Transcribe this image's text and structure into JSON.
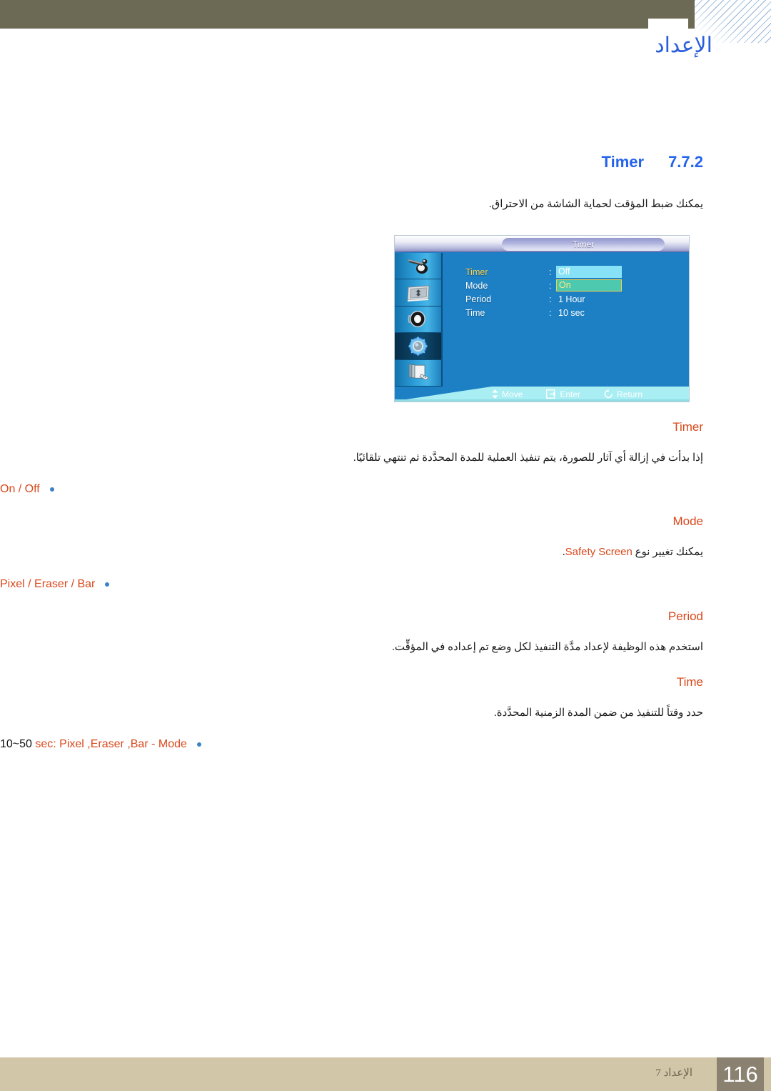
{
  "header": {
    "chapter_title": "الإعداد",
    "notch_icon": "page-corner-notch",
    "hatch_icon": "diagonal-hatch-decoration"
  },
  "section": {
    "number": "7.7.2",
    "name": "Timer",
    "intro": "يمكنك ضبط المؤقت لحماية الشاشة من الاحتراق."
  },
  "osd": {
    "title": "Timer",
    "sidebar_icons": [
      {
        "name": "picture-icon"
      },
      {
        "name": "screen-adjust-icon"
      },
      {
        "name": "sound-speaker-icon"
      },
      {
        "name": "setup-gear-icon",
        "selected": true
      },
      {
        "name": "multi-control-icon"
      }
    ],
    "rows": [
      {
        "label": "Timer",
        "colon": ":",
        "value": "Off",
        "style": "box-cyan",
        "label_highlight": true
      },
      {
        "label": "Mode",
        "colon": ":",
        "value": "On",
        "style": "box-teal",
        "label_highlight": false
      },
      {
        "label": "Period",
        "colon": ":",
        "value": "1 Hour",
        "style": "plain",
        "label_highlight": false
      },
      {
        "label": "Time",
        "colon": ":",
        "value": "10 sec",
        "style": "plain",
        "label_highlight": false
      }
    ],
    "footer": [
      {
        "icon": "up-down-arrow-icon",
        "label": "Move"
      },
      {
        "icon": "enter-key-icon",
        "label": "Enter"
      },
      {
        "icon": "return-arrow-icon",
        "label": "Return"
      }
    ]
  },
  "blocks": [
    {
      "heading": "Timer",
      "paragraph_ar": "إذا بدأت في إزالة أي آثار للصورة، يتم تنفيذ العملية للمدة المحدَّدة ثم تنتهي تلقائيًا.",
      "bullet": "On / Off"
    },
    {
      "heading": "Mode",
      "paragraph_pre": "يمكنك تغيير نوع ",
      "paragraph_en": "Safety Screen",
      "paragraph_post": ".",
      "bullet": "Pixel / Eraser / Bar"
    },
    {
      "heading": "Period",
      "paragraph_ar": "استخدم هذه الوظيفة لإعداد مدَّة التنفيذ لكل وضع تم إعداده في المؤقِّت.",
      "bullet": null
    },
    {
      "heading": "Time",
      "paragraph_ar": "حدد وقتاً للتنفيذ من ضمن المدة الزمنية المحدَّدة.",
      "bullet_black": "10~50",
      "bullet_rest": " sec: Pixel ,Eraser ,Bar - Mode"
    }
  ],
  "footer": {
    "chapter_label": "الإعداد 7",
    "page_number": "116"
  },
  "colors": {
    "header_band": "#6c6a55",
    "chapter_blue": "#2b5fd9",
    "section_blue": "#2563eb",
    "accent_orange": "#d9481b",
    "bullet_blue": "#3b82c4",
    "footer_band": "#d2c6a8",
    "footer_pagebox": "#8b8170",
    "osd_blue": "#1d7fc4",
    "osd_value_cyan": "#88e2f7",
    "osd_value_teal": "#4dc9b0",
    "osd_label_yellow": "#ffd24a"
  }
}
